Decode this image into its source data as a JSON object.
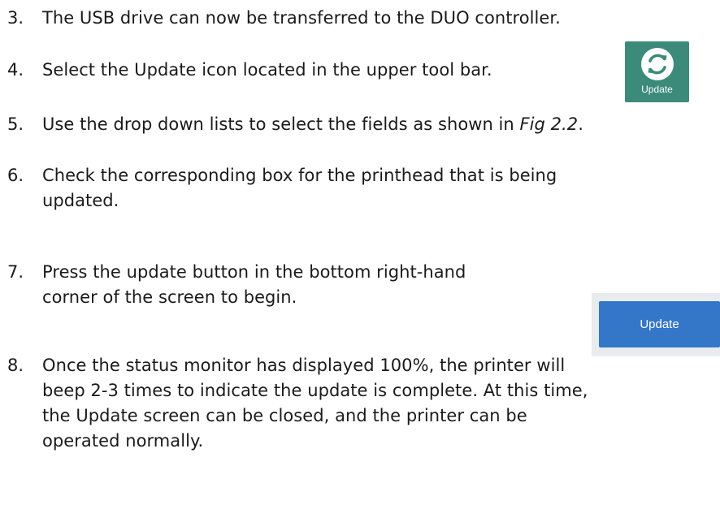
{
  "steps": [
    {
      "number": "3.",
      "lines": [
        "The USB drive can now be transferred to the DUO controller."
      ]
    },
    {
      "number": "4.",
      "lines": [
        "Select the Update icon located in the upper tool bar."
      ]
    },
    {
      "number": "5.",
      "text_before": "Use the drop down lists to select the fields as shown in ",
      "emphasis": "Fig 2.2",
      "text_after": "."
    },
    {
      "number": "6.",
      "lines": [
        "Check the corresponding box for the printhead that is being",
        "updated."
      ]
    },
    {
      "number": "7.",
      "lines": [
        "Press the update button in the bottom right-hand",
        "corner of the screen to begin."
      ]
    },
    {
      "number": "8.",
      "lines": [
        "Once the status monitor has displayed 100%, the printer will",
        "beep 2-3 times to indicate the update is complete. At this time,",
        "the Update screen can be closed, and the printer can be",
        "operated normally."
      ]
    }
  ],
  "update_icon": {
    "icon": "refresh-icon",
    "label": "Update",
    "background": "#3c8b7a"
  },
  "update_button": {
    "label": "Update",
    "background": "#3476c8"
  }
}
